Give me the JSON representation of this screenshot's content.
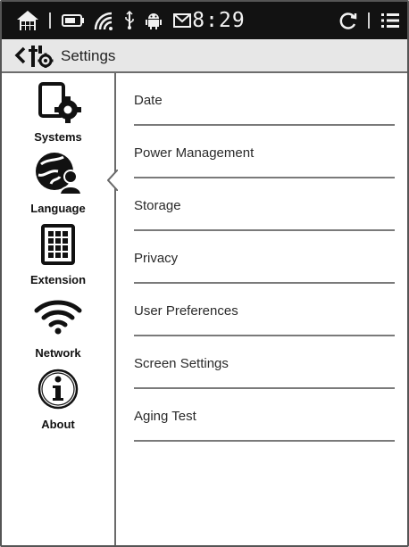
{
  "status_bar": {
    "clock": "8:29",
    "icons": [
      "home-icon",
      "battery-icon",
      "wifi-signal-icon",
      "usb-icon",
      "android-debug-icon",
      "notification-icon",
      "sync-icon",
      "menu-list-icon"
    ]
  },
  "header": {
    "title": "Settings",
    "icons": [
      "back-chevron-icon",
      "settings-tools-icon"
    ]
  },
  "sidebar": {
    "items": [
      {
        "label": "Systems",
        "icon": "tablet-gear-icon",
        "selected": true
      },
      {
        "label": "Language",
        "icon": "globe-user-icon",
        "selected": false
      },
      {
        "label": "Extension",
        "icon": "keypad-icon",
        "selected": false
      },
      {
        "label": "Network",
        "icon": "wifi-icon",
        "selected": false
      },
      {
        "label": "About",
        "icon": "info-icon",
        "selected": false
      }
    ]
  },
  "main": {
    "items": [
      {
        "label": "Date"
      },
      {
        "label": "Power Management"
      },
      {
        "label": "Storage"
      },
      {
        "label": "Privacy"
      },
      {
        "label": "User Preferences"
      },
      {
        "label": "Screen Settings"
      },
      {
        "label": "Aging Test"
      }
    ]
  },
  "colors": {
    "status_bar_bg": "#121212",
    "title_bar_bg": "#e7e7e7",
    "divider": "#7a7a7a",
    "text": "#2a2a2a"
  }
}
